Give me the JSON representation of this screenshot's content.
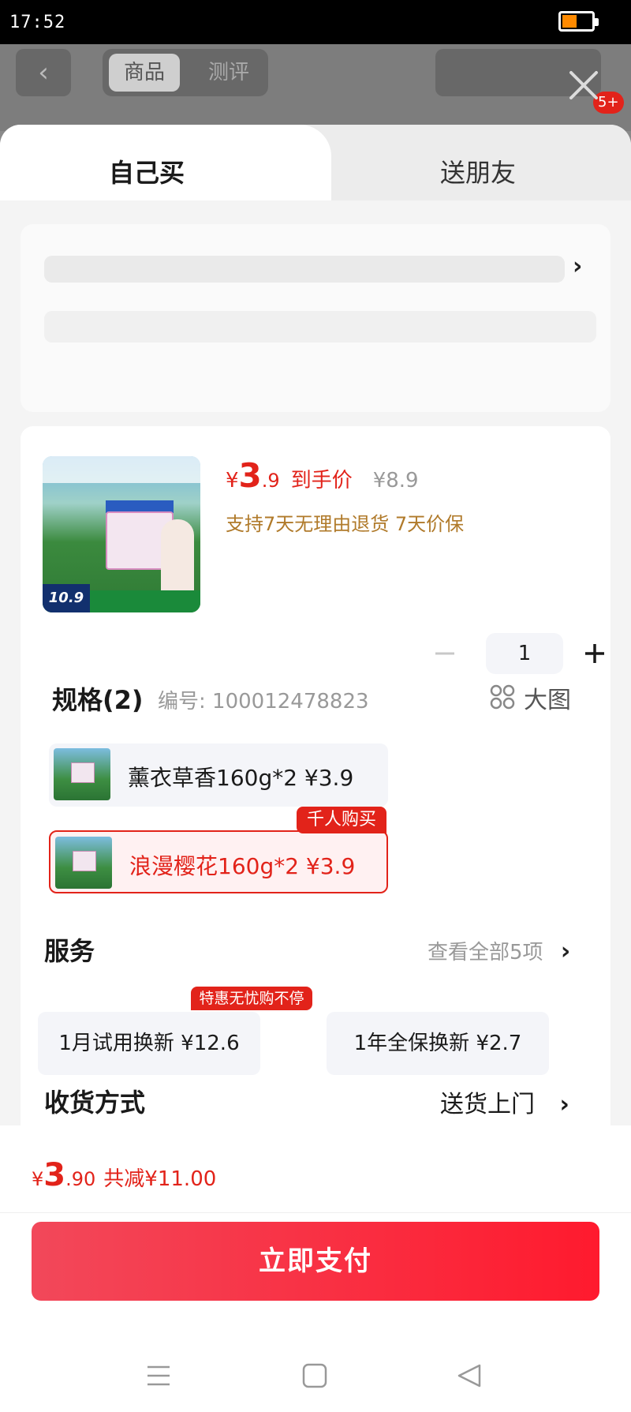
{
  "status_bar": {
    "time": "17:52"
  },
  "background_page": {
    "tabs": [
      "商品",
      "测评"
    ],
    "notification_badge": "5+"
  },
  "sheet_tabs": {
    "self": "自己买",
    "gift": "送朋友"
  },
  "product": {
    "image_price": "10.9",
    "price_currency": "¥",
    "price_int": "3",
    "price_dec": ".9",
    "price_tag": "到手价",
    "original_price": "¥8.9",
    "guarantee": "支持7天无理由退货 7天价保",
    "quantity": "1"
  },
  "spec": {
    "title": "规格(2)",
    "code": "编号: 100012478823",
    "bigview_label": "大图",
    "variants": [
      {
        "label": "薰衣草香160g*2  ¥3.9",
        "selected": false
      },
      {
        "label": "浪漫樱花160g*2  ¥3.9",
        "selected": true
      }
    ],
    "hot_tag": "千人购买"
  },
  "service": {
    "title": "服务",
    "view_all": "查看全部5项",
    "options": [
      {
        "label": "1月试用换新  ¥12.6",
        "tag": "特惠无忧购不停"
      },
      {
        "label": "1年全保换新  ¥2.7"
      }
    ]
  },
  "delivery": {
    "title": "收货方式",
    "value": "送货上门"
  },
  "footer": {
    "total_currency": "¥",
    "total_int": "3",
    "total_dec": ".90",
    "savings": "共减¥11.00",
    "pay_button": "立即支付"
  },
  "colors": {
    "accent": "#e2231a",
    "guarantee": "#b07a2a",
    "battery": "#ff8a00"
  }
}
